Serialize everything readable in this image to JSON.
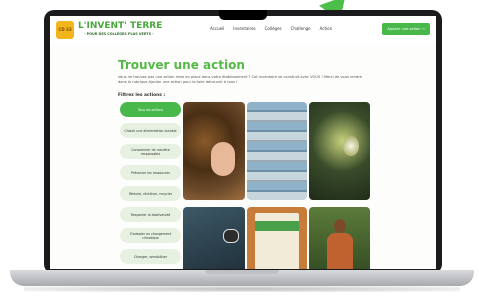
{
  "header": {
    "logo_badge": "CD 33",
    "logo_title": "L'INVENT' TERRE",
    "logo_subtitle": "- POUR DES COLLÈGES PLUS VERTS -",
    "nav": [
      "Accueil",
      "Inventaires",
      "Collèges",
      "Challenge",
      "Action"
    ],
    "cta_label": "Ajouter une action →"
  },
  "main": {
    "title": "Trouver une action",
    "intro": "Vous ne trouvez pas une action mise en place dans votre établissement ? Cet inventaire se construit avec VOUS ! Merci de vous rendre dans la rubrique Ajouter une action pour la faire découvrir à tous !",
    "filters_title": "Filtrez les actions :",
    "filters": [
      {
        "label": "Tous les actions",
        "active": true
      },
      {
        "label": "Choisir une alimentation durable",
        "active": false
      },
      {
        "label": "Consommer de manière responsable",
        "active": false
      },
      {
        "label": "Préserver les ressources",
        "active": false
      },
      {
        "label": "Réduire, réutiliser, recycler",
        "active": false
      },
      {
        "label": "Respecter la biodiversité",
        "active": false
      },
      {
        "label": "S'adapter au changement climatique",
        "active": false
      },
      {
        "label": "Changer, sensibiliser",
        "active": false
      }
    ]
  },
  "colors": {
    "accent": "#49b84a",
    "title": "#55b947",
    "chip": "#e7f1e2",
    "logo": "#f2b51c"
  }
}
